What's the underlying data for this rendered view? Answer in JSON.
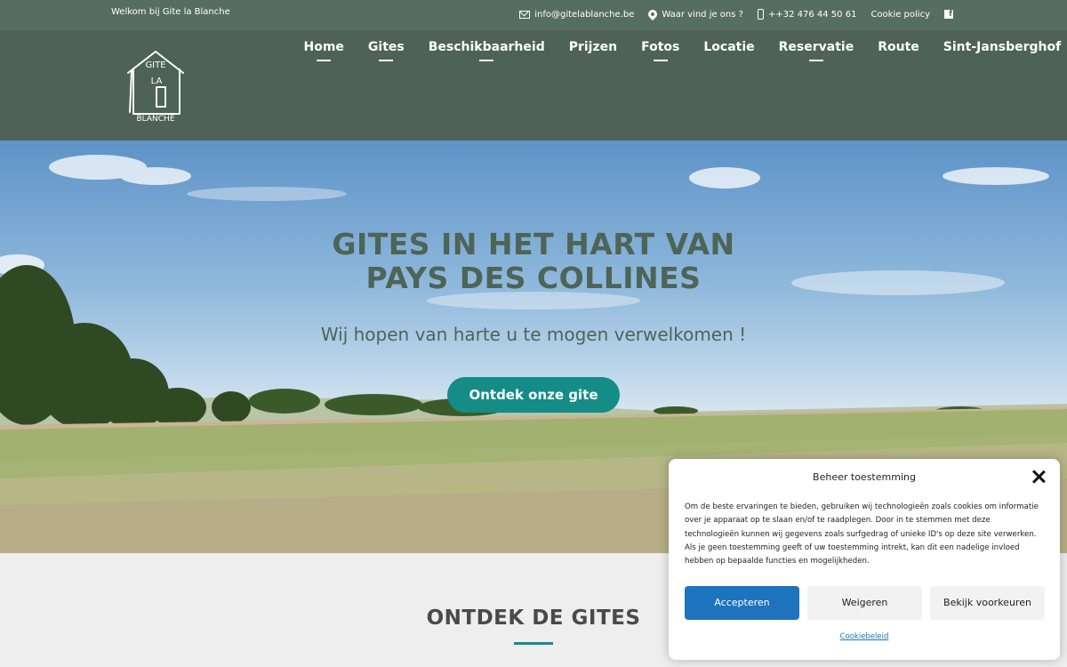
{
  "topbar": {
    "welcome": "Welkom bij Gite la Blanche",
    "email": "info@gitelablanche.be",
    "location": "Waar vind je ons ?",
    "phone": "++32 476 44 50 61",
    "cookie": "Cookie policy"
  },
  "logo": {
    "line1": "GITE",
    "line2": "LA",
    "line3": "BLANCHE"
  },
  "nav": {
    "items": [
      {
        "label": "Home"
      },
      {
        "label": "Gites"
      },
      {
        "label": "Beschikbaarheid"
      },
      {
        "label": "Prijzen"
      },
      {
        "label": "Fotos"
      },
      {
        "label": "Locatie"
      },
      {
        "label": "Reservatie"
      },
      {
        "label": "Route"
      },
      {
        "label": "Sint-Jansberghof"
      }
    ]
  },
  "hero": {
    "title_line1": "GITES IN HET HART VAN",
    "title_line2": "PAYS DES COLLINES",
    "subtitle": "Wij hopen van harte u te mogen verwelkomen !",
    "button": "Ontdek onze gite"
  },
  "section": {
    "title": "ONTDEK DE GITES"
  },
  "cookie_modal": {
    "title": "Beheer toestemming",
    "text": "Om de beste ervaringen te bieden, gebruiken wij technologieën zoals cookies om informatie over je apparaat op te slaan en/of te raadplegen. Door in te stemmen met deze technologieën kunnen wij gegevens zoals surfgedrag of unieke ID's op deze site verwerken. Als je geen toestemming geeft of uw toestemming intrekt, kan dit een nadelige invloed hebben op bepaalde functies en mogelijkheden.",
    "accept": "Accepteren",
    "deny": "Weigeren",
    "preferences": "Bekijk voorkeuren",
    "policy": "Cookiebeleid"
  },
  "colors": {
    "topbar": "#566d62",
    "header": "#4e6257",
    "accent": "#158c86",
    "primary_button": "#1e73be"
  }
}
